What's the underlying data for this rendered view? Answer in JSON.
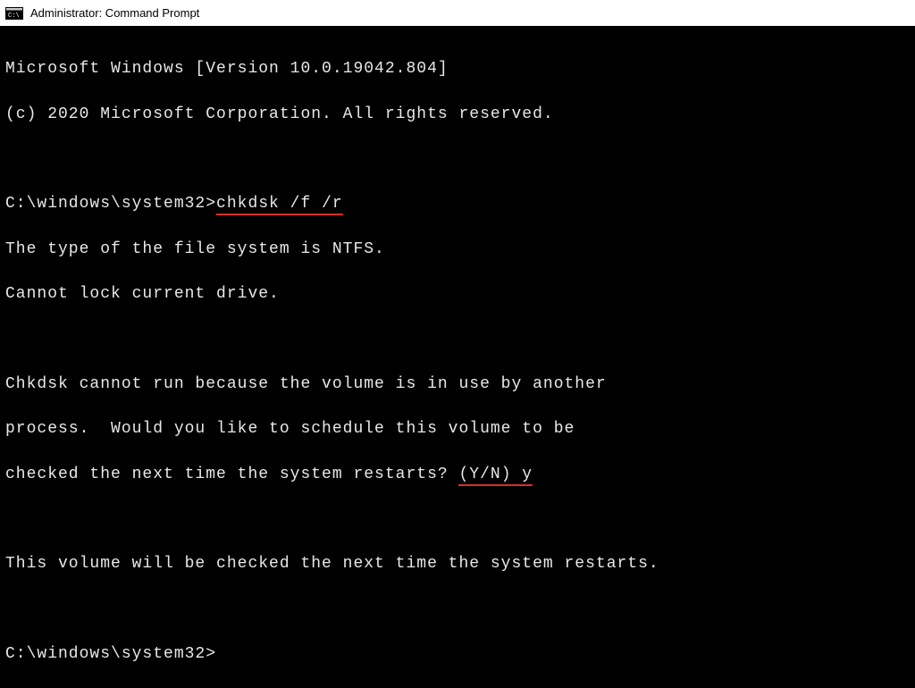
{
  "window": {
    "title": "Administrator: Command Prompt"
  },
  "terminal": {
    "line1": "Microsoft Windows [Version 10.0.19042.804]",
    "line2": "(c) 2020 Microsoft Corporation. All rights reserved.",
    "blank1": " ",
    "prompt1": "C:\\windows\\system32>",
    "command1": "chkdsk /f /r",
    "out1": "The type of the file system is NTFS.",
    "out2": "Cannot lock current drive.",
    "blank2": " ",
    "out3": "Chkdsk cannot run because the volume is in use by another",
    "out4a": "process.  Would you like to schedule this volume to be",
    "out5a": "checked the next time the system restarts? ",
    "yn": "(Y/N) y",
    "blank3": " ",
    "out6": "This volume will be checked the next time the system restarts.",
    "blank4": " ",
    "prompt2": "C:\\windows\\system32>"
  }
}
